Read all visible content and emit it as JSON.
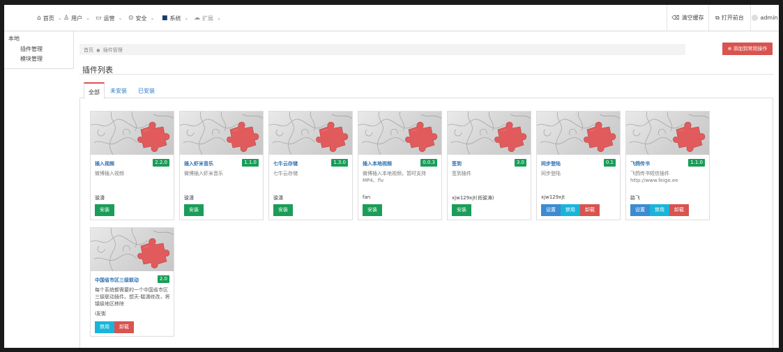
{
  "nav": {
    "items": [
      {
        "icon": "home-icon",
        "glyph": "⌂",
        "label": "首页",
        "dropdown": true
      },
      {
        "icon": "user-icon",
        "glyph": "♙",
        "label": "用户",
        "dropdown": true
      },
      {
        "icon": "monitor-icon",
        "glyph": "▭",
        "label": "运营",
        "dropdown": true
      },
      {
        "icon": "shield-icon",
        "glyph": "⊙",
        "label": "安全",
        "dropdown": true
      },
      {
        "icon": "windows-icon",
        "glyph": "■",
        "label": "系统",
        "dropdown": true
      },
      {
        "icon": "cloud-icon",
        "glyph": "☁",
        "label": "扩展",
        "dropdown": true
      }
    ],
    "dropdown_glyph": "⌄",
    "clear_cache": "清空缓存",
    "open_frontend": "打开前台",
    "username": "admin"
  },
  "sidebar": {
    "header": "本地",
    "items": [
      "插件管理",
      "模块管理"
    ]
  },
  "breadcrumb": {
    "home": "首页",
    "separator": "●",
    "current": "插件管理"
  },
  "add_shortcut_button": "添加到常用操作",
  "page_title": "插件列表",
  "tabs": [
    "全部",
    "未安装",
    "已安装"
  ],
  "plugins": [
    {
      "name": "插入视频",
      "version": "2.2.0",
      "description": "微博插入视频",
      "author": "骏濤",
      "buttons": [
        {
          "label": "安装",
          "style": "green"
        }
      ]
    },
    {
      "name": "插入虾米音乐",
      "version": "1.1.0",
      "description": "微博插入虾米音乐",
      "author": "骏濤",
      "buttons": [
        {
          "label": "安装",
          "style": "green"
        }
      ]
    },
    {
      "name": "七牛云存储",
      "version": "1.3.0",
      "description": "七牛云存储",
      "author": "骏濤",
      "buttons": [
        {
          "label": "安装",
          "style": "green"
        }
      ]
    },
    {
      "name": "插入本地视频",
      "version": "0.0.3",
      "description": "微博插入本地视频，暂时支持MP4、flv",
      "author": "fan",
      "buttons": [
        {
          "label": "安装",
          "style": "green"
        }
      ]
    },
    {
      "name": "签到",
      "version": "3.0",
      "description": "签到插件",
      "author": "xjw129xjt(肖骏涛)",
      "buttons": [
        {
          "label": "安装",
          "style": "green"
        }
      ]
    },
    {
      "name": "同步登陆",
      "version": "0.1",
      "description": "同步登陆",
      "author": "xjw129xjt",
      "buttons": [
        {
          "label": "设置",
          "style": "blue"
        },
        {
          "label": "禁用",
          "style": "cyan"
        },
        {
          "label": "卸载",
          "style": "red"
        }
      ]
    },
    {
      "name": "飞鸽传书",
      "version": "1.1.0",
      "description": "飞鸽传书短信插件 http://www.feige.ee",
      "author": "路飞",
      "buttons": [
        {
          "label": "设置",
          "style": "blue"
        },
        {
          "label": "禁用",
          "style": "cyan"
        },
        {
          "label": "卸载",
          "style": "red"
        }
      ]
    },
    {
      "name": "中国省市区三级联动",
      "version": "2.0",
      "description": "每个系统都需要的一个中国省市区三级联动插件。想天-駿濤修改，将镇级地区移除",
      "author": "i友街",
      "buttons": [
        {
          "label": "禁用",
          "style": "cyan"
        },
        {
          "label": "卸载",
          "style": "red"
        }
      ]
    }
  ],
  "colors": {
    "green": "#1a9d58",
    "blue": "#3d8bd1",
    "cyan": "#1ab4d8",
    "red": "#d9534f",
    "puzzle": "#e15b5d"
  }
}
